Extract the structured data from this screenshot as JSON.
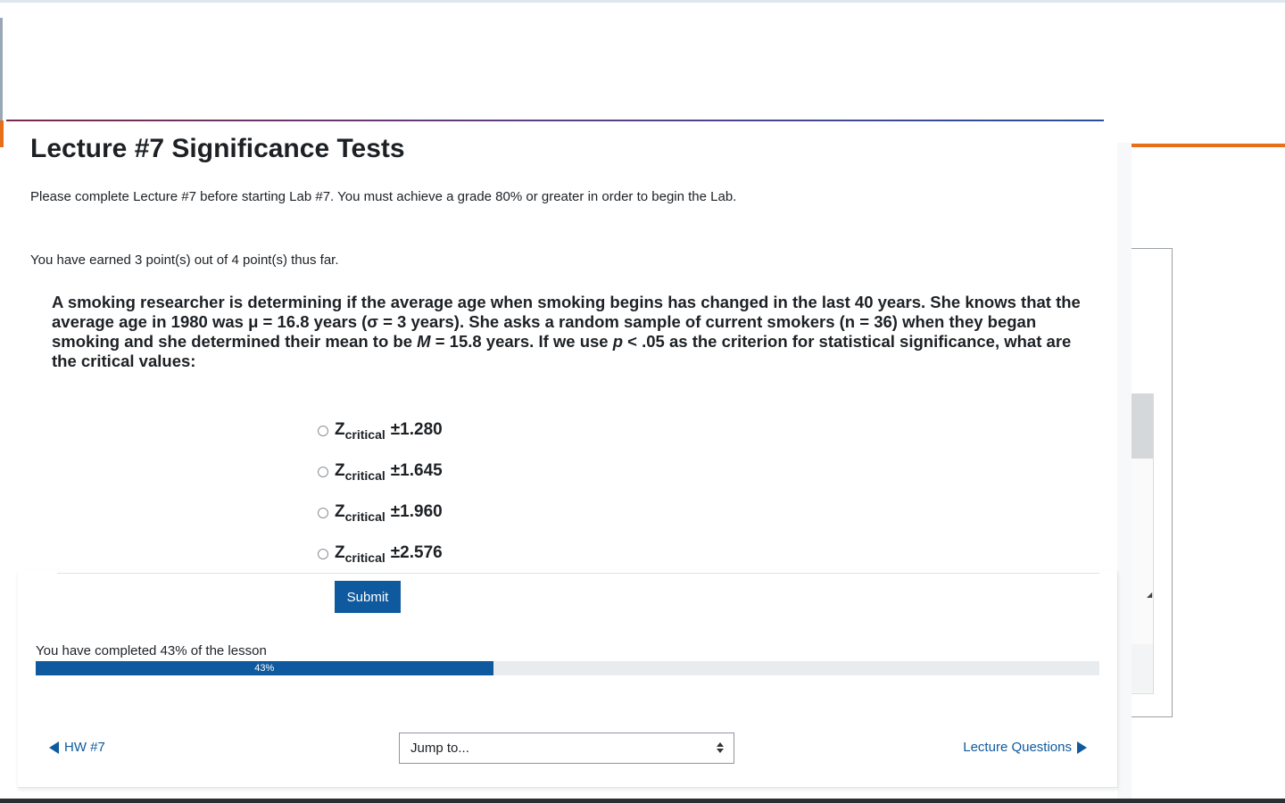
{
  "lesson": {
    "title": "Lecture #7 Significance Tests",
    "intro": "Please complete Lecture #7 before starting Lab #7. You must achieve a grade 80% or greater in order to begin the Lab.",
    "earned": "You have earned 3 point(s) out of 4 point(s) thus far."
  },
  "question": {
    "text_part1": "A smoking researcher is determining if the average age when smoking begins has changed in the last 40 years. She knows that the average age in 1980 was μ = 16.8 years (σ = 3 years). She asks a random sample of current smokers (n = 36) when they began smoking and she determined their mean to be ",
    "m_symbol": "M",
    "text_part2": " = 15.8 years. If we use ",
    "p_symbol": "p",
    "text_part3": " < .05 as the criterion for statistical significance, what are the critical values:",
    "options": [
      {
        "z": "Z",
        "sub": "critical",
        "value": "±1.280"
      },
      {
        "z": "Z",
        "sub": "critical",
        "value": "±1.645"
      },
      {
        "z": "Z",
        "sub": "critical",
        "value": "±1.960"
      },
      {
        "z": "Z",
        "sub": "critical",
        "value": "±2.576"
      }
    ],
    "submit_label": "Submit"
  },
  "progress": {
    "label": "You have completed 43% of the lesson",
    "percent": 43,
    "percent_label": "43%"
  },
  "nav": {
    "prev_label": "HW #7",
    "next_label": "Lecture Questions",
    "jump_label": "Jump to..."
  },
  "colors": {
    "primary": "#0f5a9e",
    "accent_orange": "#e76f1a"
  }
}
